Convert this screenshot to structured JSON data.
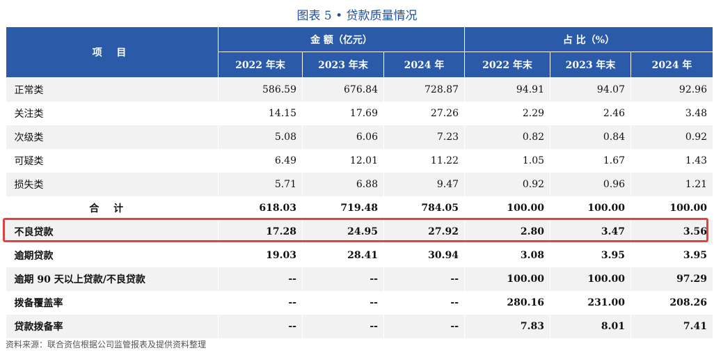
{
  "title": "图表 5 • 贷款质量情况",
  "header": {
    "item_label": "项 目",
    "group_amount": "金 额（亿元）",
    "group_ratio": "占 比（%）",
    "years": [
      "2022 年末",
      "2023 年末",
      "2024 年",
      "2022 年末",
      "2023 年末",
      "2024 年"
    ]
  },
  "rows": [
    {
      "label": "正常类",
      "values": [
        "586.59",
        "676.84",
        "728.87",
        "94.91",
        "94.07",
        "92.96"
      ]
    },
    {
      "label": "关注类",
      "values": [
        "14.15",
        "17.69",
        "27.26",
        "2.29",
        "2.46",
        "3.48"
      ]
    },
    {
      "label": "次级类",
      "values": [
        "5.08",
        "6.06",
        "7.23",
        "0.82",
        "0.84",
        "0.92"
      ]
    },
    {
      "label": "可疑类",
      "values": [
        "6.49",
        "12.01",
        "11.22",
        "1.05",
        "1.67",
        "1.43"
      ]
    },
    {
      "label": "损失类",
      "values": [
        "5.71",
        "6.88",
        "9.47",
        "0.92",
        "0.96",
        "1.21"
      ]
    },
    {
      "label": "合 计",
      "values": [
        "618.03",
        "719.48",
        "784.05",
        "100.00",
        "100.00",
        "100.00"
      ]
    },
    {
      "label": "不良贷款",
      "values": [
        "17.28",
        "24.95",
        "27.92",
        "2.80",
        "3.47",
        "3.56"
      ]
    },
    {
      "label": "逾期贷款",
      "values": [
        "19.03",
        "28.41",
        "30.94",
        "3.08",
        "3.95",
        "3.95"
      ]
    },
    {
      "label": "逾期 90 天以上贷款/不良贷款",
      "values": [
        "--",
        "--",
        "--",
        "100.00",
        "100.00",
        "97.29"
      ]
    },
    {
      "label": "拨备覆盖率",
      "values": [
        "--",
        "--",
        "--",
        "280.16",
        "231.00",
        "208.26"
      ]
    },
    {
      "label": "贷款拨备率",
      "values": [
        "--",
        "--",
        "--",
        "7.83",
        "8.01",
        "7.41"
      ]
    }
  ],
  "highlight_color": "#e0423f",
  "header_color": "#2b5aa8",
  "source": "资料来源：联合资信根据公司监管报表及提供资料整理"
}
